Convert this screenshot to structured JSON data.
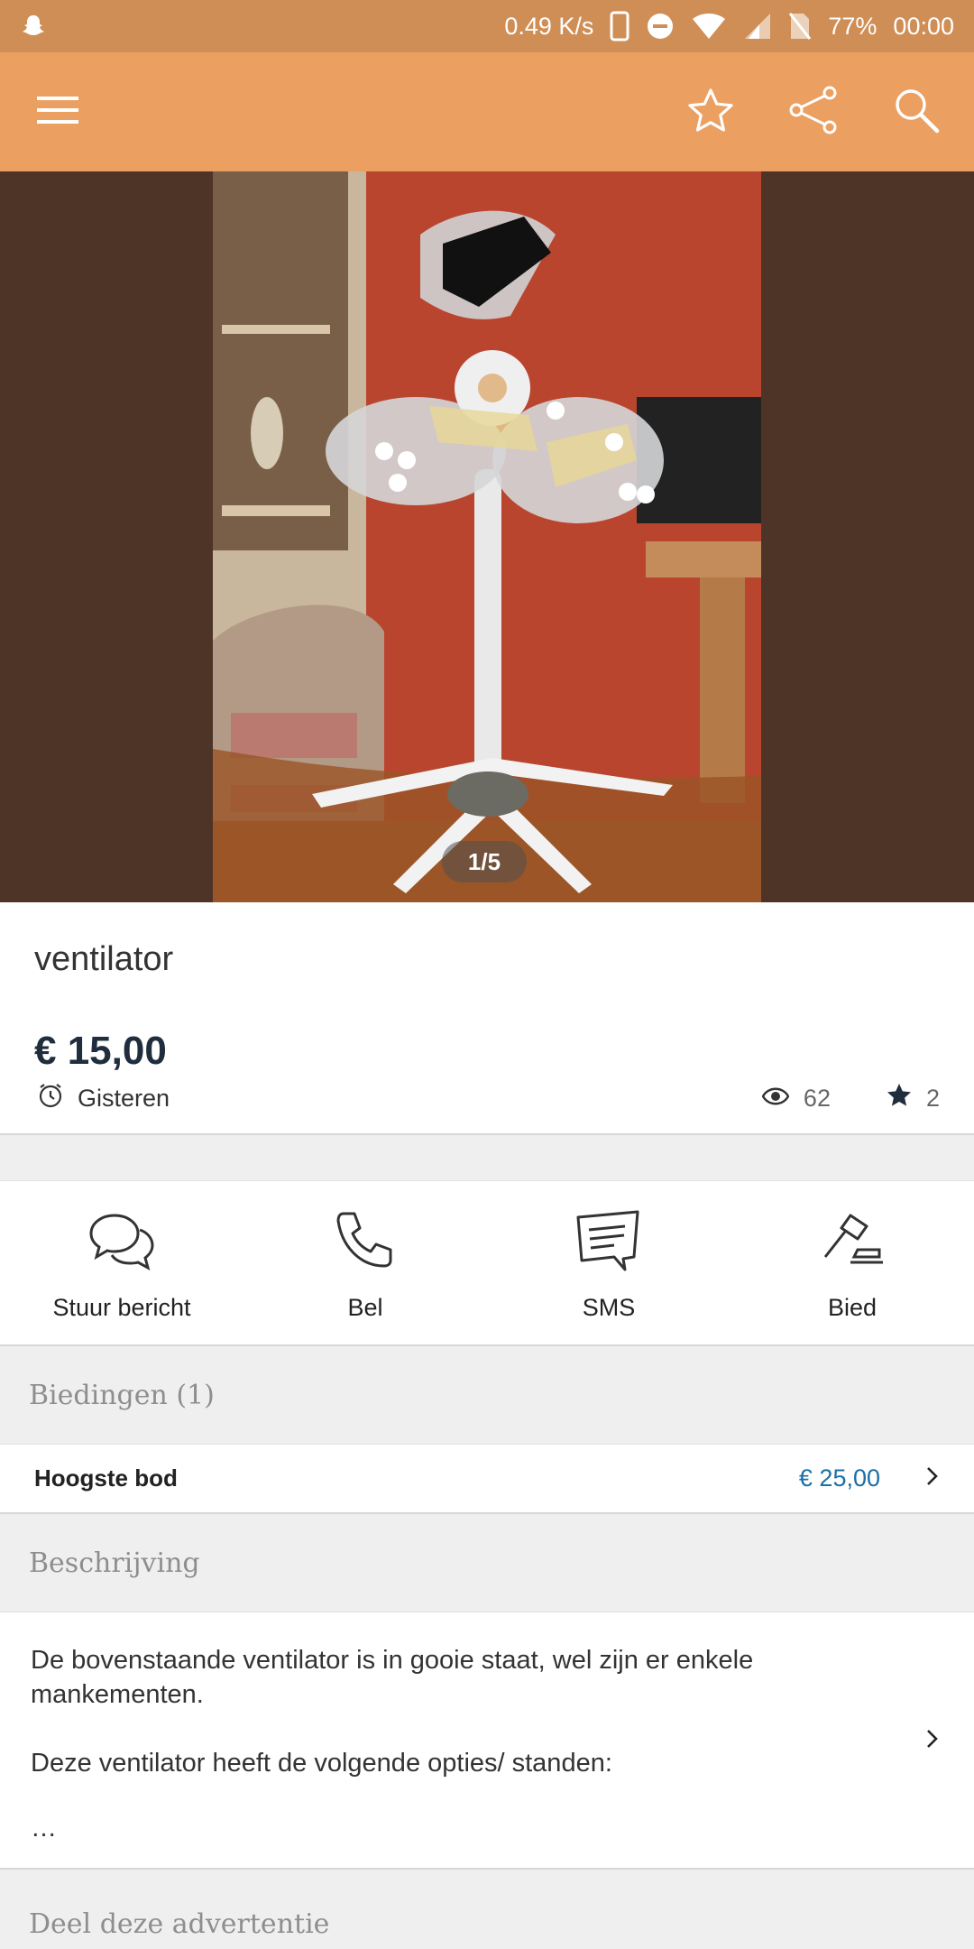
{
  "status_bar": {
    "network_speed": "0.49 K/s",
    "battery": "77%",
    "time": "00:00"
  },
  "app_bar": {
    "menu_icon": "hamburger-icon",
    "favorite_icon": "star-outline-icon",
    "share_icon": "share-icon",
    "search_icon": "search-icon",
    "background": "#eba062"
  },
  "photo": {
    "counter": "1/5"
  },
  "listing": {
    "title": "ventilator",
    "price": "€ 15,00",
    "date": "Gisteren",
    "views": "62",
    "favorites": "2"
  },
  "contact_actions": [
    {
      "label": "Stuur bericht",
      "icon": "chat-bubbles-icon"
    },
    {
      "label": "Bel",
      "icon": "phone-icon"
    },
    {
      "label": "SMS",
      "icon": "sms-icon"
    },
    {
      "label": "Bied",
      "icon": "gavel-icon"
    }
  ],
  "bids": {
    "header": "Biedingen (1)",
    "highest_label": "Hoogste bod",
    "highest_value": "€ 25,00"
  },
  "description": {
    "header": "Beschrijving",
    "paragraph1": "De bovenstaande ventilator is in gooie staat, wel zijn er enkele mankementen.",
    "paragraph2": "Deze ventilator heeft de volgende opties/ standen:",
    "ellipsis": "…"
  },
  "share": {
    "header": "Deel deze advertentie"
  }
}
